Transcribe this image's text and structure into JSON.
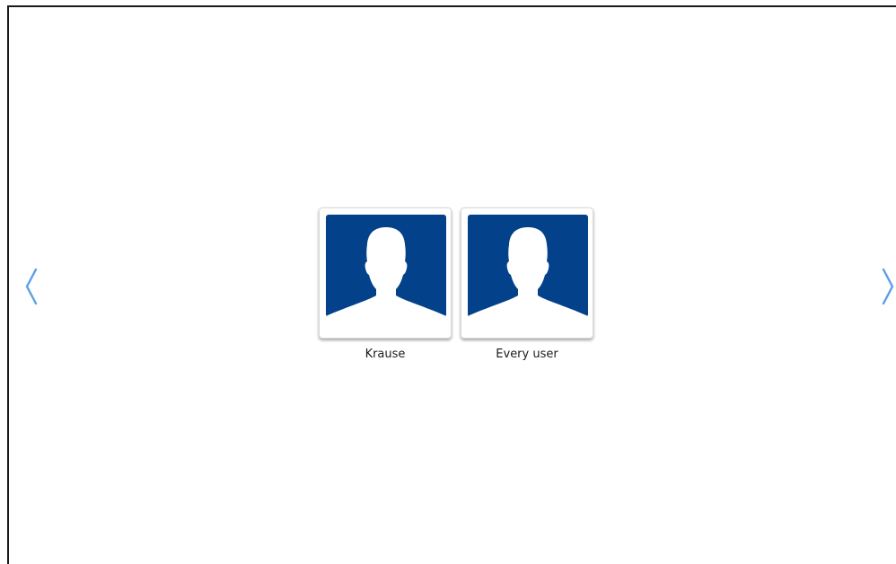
{
  "carousel": {
    "prev_icon": "chevron-left-icon",
    "next_icon": "chevron-right-icon",
    "arrow_color": "#5b9ee6"
  },
  "users": [
    {
      "name": "Krause",
      "avatar_icon": "person-silhouette-icon"
    },
    {
      "name": "Every user",
      "avatar_icon": "person-silhouette-icon"
    }
  ],
  "colors": {
    "avatar_background": "#03428b",
    "silhouette": "#ffffff"
  }
}
